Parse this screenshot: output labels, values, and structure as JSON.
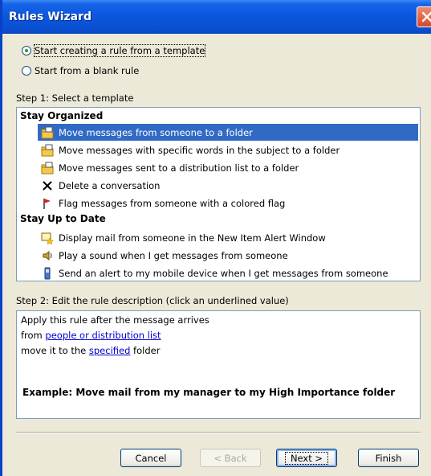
{
  "window": {
    "title": "Rules Wizard"
  },
  "options": {
    "template": "Start creating a rule from a template",
    "blank": "Start from a blank rule"
  },
  "step1": {
    "label": "Step 1: Select a template",
    "groups": [
      {
        "name": "Stay Organized",
        "items": [
          {
            "label": "Move messages from someone to a folder",
            "icon": "move-folder-icon"
          },
          {
            "label": "Move messages with specific words in the subject to a folder",
            "icon": "move-folder-icon"
          },
          {
            "label": "Move messages sent to a distribution list to a folder",
            "icon": "move-folder-icon"
          },
          {
            "label": "Delete a conversation",
            "icon": "delete-x-icon"
          },
          {
            "label": "Flag messages from someone with a colored flag",
            "icon": "flag-icon"
          }
        ]
      },
      {
        "name": "Stay Up to Date",
        "items": [
          {
            "label": "Display mail from someone in the New Item Alert Window",
            "icon": "alert-window-icon"
          },
          {
            "label": "Play a sound when I get messages from someone",
            "icon": "sound-icon"
          },
          {
            "label": "Send an alert to my mobile device when I get messages from someone",
            "icon": "mobile-device-icon"
          }
        ]
      }
    ]
  },
  "step2": {
    "label": "Step 2: Edit the rule description (click an underlined value)",
    "line1": "Apply this rule after the message arrives",
    "line2_prefix": "from ",
    "line2_link": "people or distribution list",
    "line3_prefix": "move it to the ",
    "line3_link": "specified",
    "line3_suffix": " folder",
    "example": "Example: Move mail from my manager to my High Importance folder"
  },
  "buttons": {
    "cancel": "Cancel",
    "back": "< Back",
    "next": "Next >",
    "finish": "Finish"
  },
  "colors": {
    "selection": "#316AC5",
    "link": "#0000CC",
    "titlebar": "#0A56DC"
  }
}
